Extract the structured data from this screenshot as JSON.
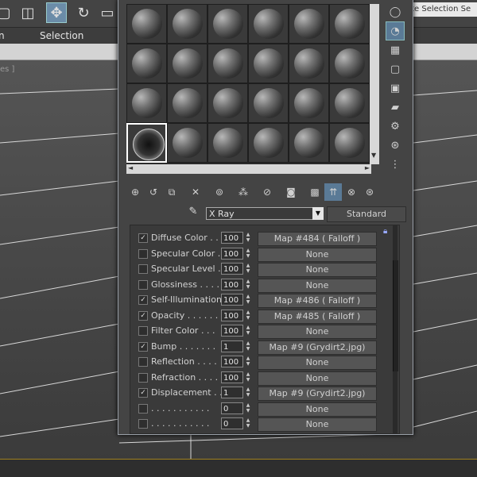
{
  "app": {
    "named_selection": "ate Selection Se",
    "menu": [
      "n",
      "Selection"
    ],
    "viewport_label": "es ]"
  },
  "material_editor": {
    "slots": {
      "rows": 4,
      "cols": 6,
      "active_index": 18
    },
    "material_name": "X Ray",
    "material_type": "Standard",
    "maps": [
      {
        "checked": true,
        "label": "Diffuse Color . .",
        "amount": "100",
        "map": "Map #484  ( Falloff )"
      },
      {
        "checked": false,
        "label": "Specular Color  .",
        "amount": "100",
        "map": "None"
      },
      {
        "checked": false,
        "label": "Specular Level  .",
        "amount": "100",
        "map": "None"
      },
      {
        "checked": false,
        "label": "Glossiness  . . . .",
        "amount": "100",
        "map": "None"
      },
      {
        "checked": true,
        "label": "Self-Illumination .",
        "amount": "100",
        "map": "Map #486  ( Falloff )"
      },
      {
        "checked": true,
        "label": "Opacity . . . . . .",
        "amount": "100",
        "map": "Map #485  ( Falloff )"
      },
      {
        "checked": false,
        "label": "Filter Color  . . .",
        "amount": "100",
        "map": "None"
      },
      {
        "checked": true,
        "label": "Bump  . . . . . . .",
        "amount": "1",
        "map": "Map #9 (Grydirt2.jpg)"
      },
      {
        "checked": false,
        "label": "Reflection  . . . .",
        "amount": "100",
        "map": "None"
      },
      {
        "checked": false,
        "label": "Refraction  . . . .",
        "amount": "100",
        "map": "None"
      },
      {
        "checked": true,
        "label": "Displacement  . .",
        "amount": "1",
        "map": "Map #9 (Grydirt2.jpg)"
      },
      {
        "checked": false,
        "label": ". . . . . . . . . . .",
        "amount": "0",
        "map": "None"
      },
      {
        "checked": false,
        "label": ". . . . . . . . . . .",
        "amount": "0",
        "map": "None"
      }
    ]
  }
}
